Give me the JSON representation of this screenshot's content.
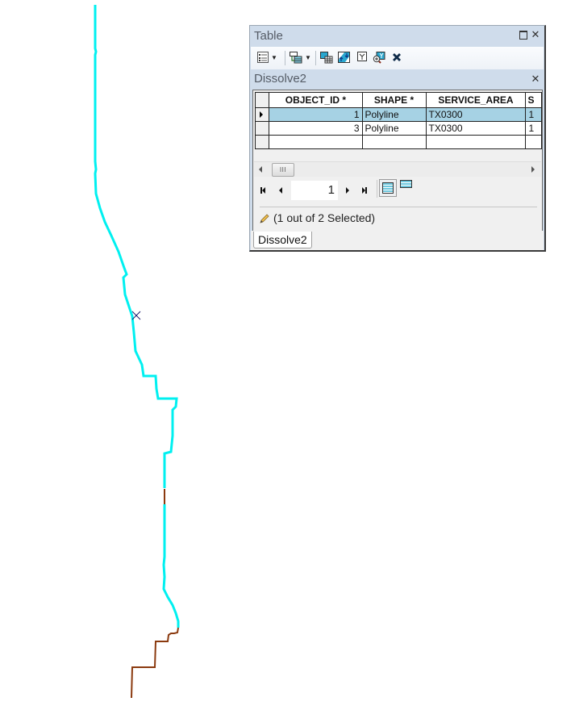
{
  "map": {
    "colors": {
      "selected_feature": "#00f0f0",
      "unselected_feature": "#8b3a0f",
      "marker": "#1a1a6e"
    },
    "cursor_marker": "x-marker"
  },
  "table_window": {
    "title": "Table",
    "maximize_icon": "maximize-icon",
    "close_icon": "close-icon",
    "toolbar": [
      {
        "name": "table-options",
        "icon": "table-options-icon",
        "has_dropdown": true
      },
      {
        "name": "related-tables",
        "icon": "related-tables-icon",
        "has_dropdown": true
      },
      {
        "name": "select-by-attributes",
        "icon": "select-by-attributes-icon"
      },
      {
        "name": "switch-selection",
        "icon": "switch-selection-icon"
      },
      {
        "name": "clear-selection",
        "icon": "clear-selection-icon"
      },
      {
        "name": "zoom-to-selected",
        "icon": "zoom-to-selected-icon"
      },
      {
        "name": "delete-selected",
        "icon": "delete-icon"
      }
    ],
    "layer_title": "Dissolve2",
    "grid": {
      "columns": [
        "OBJECT_ID *",
        "SHAPE *",
        "SERVICE_AREA",
        "S"
      ],
      "rows": [
        {
          "selected": true,
          "current": true,
          "cells": [
            "1",
            "Polyline",
            "TX0300",
            "1"
          ]
        },
        {
          "selected": false,
          "current": false,
          "cells": [
            "3",
            "Polyline",
            "TX0300",
            "1"
          ]
        },
        {
          "selected": false,
          "current": false,
          "cells": [
            "",
            "",
            "",
            ""
          ]
        }
      ],
      "scroll_thumb_label": "III"
    },
    "navigation": {
      "current_record": "1",
      "view_mode": "show-all-records"
    },
    "status": "(1 out of 2 Selected)",
    "tabs": [
      {
        "label": "Dissolve2",
        "active": true
      }
    ]
  }
}
